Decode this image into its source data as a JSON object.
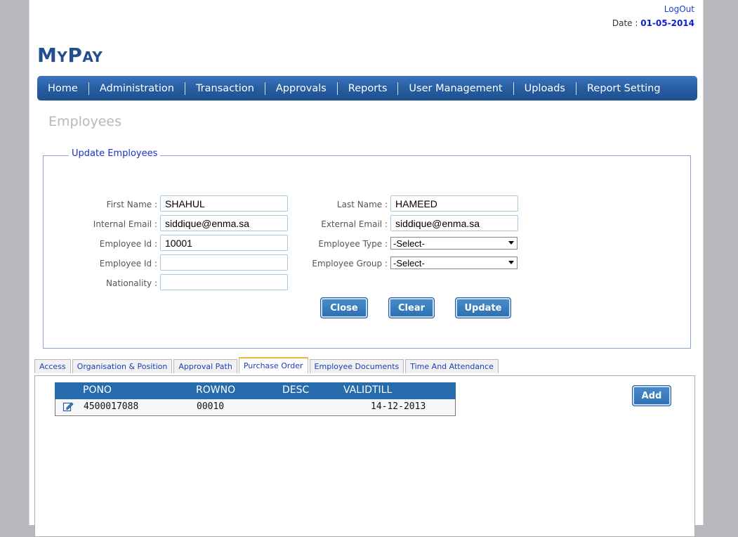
{
  "header": {
    "logout_label": "LogOut",
    "date_label": "Date :",
    "date_value": "01-05-2014",
    "logo": "MyPay"
  },
  "nav": {
    "items": [
      "Home",
      "Administration",
      "Transaction",
      "Approvals",
      "Reports",
      "User Management",
      "Uploads",
      "Report Setting"
    ]
  },
  "page_title": "Employees",
  "form": {
    "legend": "Update Employees",
    "first_name_label": "First Name :",
    "first_name_value": "SHAHUL",
    "last_name_label": "Last Name :",
    "last_name_value": "HAMEED",
    "internal_email_label": "Internal Email :",
    "internal_email_value": "siddique@enma.sa",
    "external_email_label": "External Email :",
    "external_email_value": "siddique@enma.sa",
    "employee_id_label": "Employee Id :",
    "employee_id_value": "10001",
    "employee_type_label": "Employee Type :",
    "employee_type_value": "-Select-",
    "employee_id2_label": "Employee Id :",
    "employee_id2_value": "",
    "employee_group_label": "Employee Group :",
    "employee_group_value": "-Select-",
    "nationality_label": "Nationality :",
    "nationality_value": "",
    "close_label": "Close",
    "clear_label": "Clear",
    "update_label": "Update"
  },
  "tabs": {
    "items": [
      "Access",
      "Organisation & Position",
      "Approval Path",
      "Purchase Order",
      "Employee Documents",
      "Time And Attendance"
    ],
    "active": "Purchase Order"
  },
  "purchase_order": {
    "columns": [
      "PONO",
      "ROWNO",
      "DESC",
      "VALIDTILL"
    ],
    "rows": [
      {
        "pono": "4500017088",
        "rowno": "00010",
        "desc": "",
        "validtill": "14-12-2013"
      }
    ],
    "add_label": "Add"
  },
  "colors": {
    "nav_bg": "#255c9f",
    "button_bg": "#2c6fb1",
    "grid_header_bg": "#266bac",
    "active_tab_accent": "#f2b63a"
  }
}
